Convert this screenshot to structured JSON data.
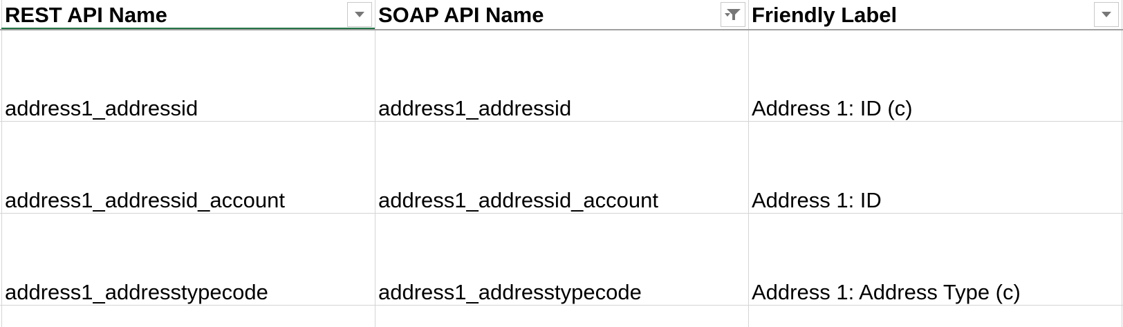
{
  "sheet": {
    "headers": [
      {
        "label": "REST API Name",
        "filter_icon": "dropdown-arrow-icon"
      },
      {
        "label": "SOAP API Name",
        "filter_icon": "filter-applied-icon"
      },
      {
        "label": "Friendly Label",
        "filter_icon": "dropdown-arrow-icon"
      }
    ],
    "rows": [
      [
        "address1_addressid",
        "address1_addressid",
        "Address 1: ID (c)"
      ],
      [
        "address1_addressid_account",
        "address1_addressid_account",
        "Address 1: ID"
      ],
      [
        "address1_addresstypecode",
        "address1_addresstypecode",
        "Address 1: Address Type (c)"
      ]
    ]
  },
  "colors": {
    "gridline": "#d4d4d4",
    "header_border": "#9e9e9e",
    "active_cell_accent": "#217346",
    "filter_icon": "#777777"
  }
}
